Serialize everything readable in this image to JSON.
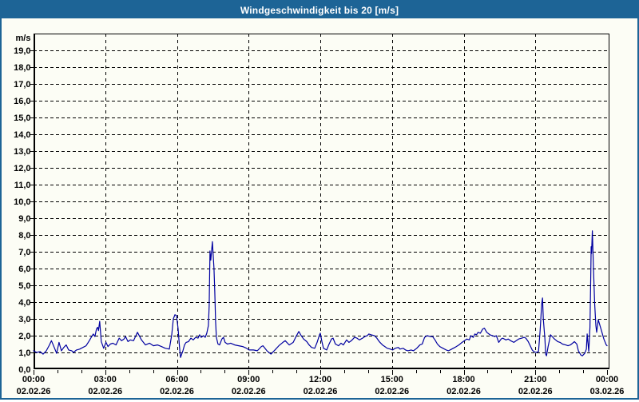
{
  "window": {
    "title": "Windgeschwindigkeit bis 20 [m/s]",
    "title_bar_color": "#1d6496",
    "border_color": "#1d6496",
    "background_color": "#fcfdf5"
  },
  "chart_data": {
    "type": "line",
    "title": "Windgeschwindigkeit bis 20 [m/s]",
    "unit_label": "m/s",
    "ylabel": "m/s",
    "xlabel": "",
    "ylim": [
      0,
      20
    ],
    "y_tick_interval": 1.0,
    "y_tick_labels": [
      "0,0",
      "1,0",
      "2,0",
      "3,0",
      "4,0",
      "5,0",
      "6,0",
      "7,0",
      "8,0",
      "9,0",
      "10,0",
      "11,0",
      "12,0",
      "13,0",
      "14,0",
      "15,0",
      "16,0",
      "17,0",
      "18,0",
      "19,0"
    ],
    "x_total_minutes": 1440,
    "x_minor_tick_minutes": 60,
    "x_major_tick_minutes": 180,
    "grid": "dashed",
    "legend": "none",
    "line_color": "#0000a0",
    "x_ticks": [
      {
        "minutes": 0,
        "time": "00:00",
        "date": "02.02.26"
      },
      {
        "minutes": 180,
        "time": "03:00",
        "date": "02.02.26"
      },
      {
        "minutes": 360,
        "time": "06:00",
        "date": "02.02.26"
      },
      {
        "minutes": 540,
        "time": "09:00",
        "date": "02.02.26"
      },
      {
        "minutes": 720,
        "time": "12:00",
        "date": "02.02.26"
      },
      {
        "minutes": 900,
        "time": "15:00",
        "date": "02.02.26"
      },
      {
        "minutes": 1080,
        "time": "18:00",
        "date": "02.02.26"
      },
      {
        "minutes": 1260,
        "time": "21:00",
        "date": "02.02.26"
      },
      {
        "minutes": 1440,
        "time": "00:00",
        "date": "03.02.26"
      }
    ],
    "series": [
      {
        "name": "Windgeschwindigkeit [m/s]",
        "points": [
          [
            0,
            1.1
          ],
          [
            8,
            1.0
          ],
          [
            16,
            1.05
          ],
          [
            24,
            0.9
          ],
          [
            32,
            1.1
          ],
          [
            40,
            1.45
          ],
          [
            45,
            1.7
          ],
          [
            52,
            1.3
          ],
          [
            58,
            0.95
          ],
          [
            64,
            1.6
          ],
          [
            70,
            1.1
          ],
          [
            76,
            1.3
          ],
          [
            82,
            1.45
          ],
          [
            88,
            1.15
          ],
          [
            96,
            1.1
          ],
          [
            100,
            1.0
          ],
          [
            108,
            1.15
          ],
          [
            116,
            1.2
          ],
          [
            124,
            1.3
          ],
          [
            132,
            1.4
          ],
          [
            140,
            1.7
          ],
          [
            146,
            1.95
          ],
          [
            150,
            2.1
          ],
          [
            154,
            1.95
          ],
          [
            158,
            2.4
          ],
          [
            161,
            2.5
          ],
          [
            163,
            2.3
          ],
          [
            166,
            2.85
          ],
          [
            170,
            1.65
          ],
          [
            176,
            1.25
          ],
          [
            182,
            1.6
          ],
          [
            187,
            1.35
          ],
          [
            193,
            1.5
          ],
          [
            199,
            1.55
          ],
          [
            207,
            1.45
          ],
          [
            215,
            1.85
          ],
          [
            221,
            1.7
          ],
          [
            227,
            1.8
          ],
          [
            231,
            1.95
          ],
          [
            237,
            1.65
          ],
          [
            243,
            1.75
          ],
          [
            251,
            1.7
          ],
          [
            261,
            2.2
          ],
          [
            271,
            1.75
          ],
          [
            281,
            1.45
          ],
          [
            291,
            1.55
          ],
          [
            301,
            1.4
          ],
          [
            311,
            1.45
          ],
          [
            321,
            1.35
          ],
          [
            331,
            1.25
          ],
          [
            341,
            1.2
          ],
          [
            347,
            2.05
          ],
          [
            351,
            3.0
          ],
          [
            355,
            3.25
          ],
          [
            359,
            3.2
          ],
          [
            363,
            2.4
          ],
          [
            366,
            1.45
          ],
          [
            369,
            0.7
          ],
          [
            375,
            1.1
          ],
          [
            379,
            1.45
          ],
          [
            383,
            1.6
          ],
          [
            389,
            1.65
          ],
          [
            395,
            1.85
          ],
          [
            401,
            1.75
          ],
          [
            407,
            1.9
          ],
          [
            413,
            1.85
          ],
          [
            417,
            2.05
          ],
          [
            421,
            1.9
          ],
          [
            427,
            2.0
          ],
          [
            431,
            1.9
          ],
          [
            435,
            2.15
          ],
          [
            439,
            2.6
          ],
          [
            441,
            3.8
          ],
          [
            443,
            7.05
          ],
          [
            445,
            6.5
          ],
          [
            449,
            7.6
          ],
          [
            453,
            6.0
          ],
          [
            455,
            4.6
          ],
          [
            457,
            2.85
          ],
          [
            459,
            1.9
          ],
          [
            463,
            1.5
          ],
          [
            467,
            1.45
          ],
          [
            473,
            1.8
          ],
          [
            477,
            1.9
          ],
          [
            481,
            1.6
          ],
          [
            487,
            1.5
          ],
          [
            495,
            1.55
          ],
          [
            505,
            1.45
          ],
          [
            515,
            1.4
          ],
          [
            525,
            1.35
          ],
          [
            535,
            1.25
          ],
          [
            541,
            1.15
          ],
          [
            552,
            1.15
          ],
          [
            562,
            1.1
          ],
          [
            572,
            1.35
          ],
          [
            576,
            1.4
          ],
          [
            586,
            1.1
          ],
          [
            596,
            0.9
          ],
          [
            606,
            1.15
          ],
          [
            616,
            1.4
          ],
          [
            626,
            1.6
          ],
          [
            632,
            1.7
          ],
          [
            642,
            1.45
          ],
          [
            652,
            1.6
          ],
          [
            658,
            1.9
          ],
          [
            666,
            2.25
          ],
          [
            672,
            2.0
          ],
          [
            678,
            1.8
          ],
          [
            686,
            1.65
          ],
          [
            692,
            1.45
          ],
          [
            698,
            1.3
          ],
          [
            706,
            1.25
          ],
          [
            712,
            1.6
          ],
          [
            718,
            2.05
          ],
          [
            720,
            2.15
          ],
          [
            724,
            1.65
          ],
          [
            728,
            1.25
          ],
          [
            736,
            1.15
          ],
          [
            742,
            1.5
          ],
          [
            748,
            1.8
          ],
          [
            752,
            1.85
          ],
          [
            758,
            1.5
          ],
          [
            766,
            1.4
          ],
          [
            772,
            1.55
          ],
          [
            778,
            1.45
          ],
          [
            786,
            1.75
          ],
          [
            792,
            1.6
          ],
          [
            798,
            1.7
          ],
          [
            806,
            1.9
          ],
          [
            812,
            1.85
          ],
          [
            818,
            1.75
          ],
          [
            826,
            1.85
          ],
          [
            832,
            1.95
          ],
          [
            838,
            2.0
          ],
          [
            842,
            2.1
          ],
          [
            848,
            2.05
          ],
          [
            856,
            2.0
          ],
          [
            862,
            1.85
          ],
          [
            868,
            1.65
          ],
          [
            876,
            1.45
          ],
          [
            882,
            1.35
          ],
          [
            888,
            1.25
          ],
          [
            896,
            1.2
          ],
          [
            902,
            1.15
          ],
          [
            908,
            1.25
          ],
          [
            916,
            1.3
          ],
          [
            920,
            1.2
          ],
          [
            928,
            1.25
          ],
          [
            934,
            1.15
          ],
          [
            940,
            1.1
          ],
          [
            948,
            1.15
          ],
          [
            954,
            1.1
          ],
          [
            962,
            1.25
          ],
          [
            970,
            1.45
          ],
          [
            976,
            1.5
          ],
          [
            982,
            1.9
          ],
          [
            988,
            2.0
          ],
          [
            996,
            1.95
          ],
          [
            1002,
            1.95
          ],
          [
            1008,
            1.75
          ],
          [
            1014,
            1.5
          ],
          [
            1020,
            1.35
          ],
          [
            1028,
            1.25
          ],
          [
            1036,
            1.15
          ],
          [
            1042,
            1.1
          ],
          [
            1050,
            1.2
          ],
          [
            1058,
            1.3
          ],
          [
            1068,
            1.45
          ],
          [
            1076,
            1.6
          ],
          [
            1082,
            1.7
          ],
          [
            1088,
            1.8
          ],
          [
            1094,
            1.75
          ],
          [
            1098,
            2.0
          ],
          [
            1104,
            1.9
          ],
          [
            1108,
            2.1
          ],
          [
            1112,
            2.05
          ],
          [
            1116,
            2.2
          ],
          [
            1122,
            2.15
          ],
          [
            1128,
            2.4
          ],
          [
            1132,
            2.45
          ],
          [
            1138,
            2.2
          ],
          [
            1146,
            2.05
          ],
          [
            1152,
            2.0
          ],
          [
            1158,
            1.95
          ],
          [
            1162,
            2.0
          ],
          [
            1168,
            1.6
          ],
          [
            1174,
            1.8
          ],
          [
            1178,
            1.85
          ],
          [
            1186,
            1.75
          ],
          [
            1192,
            1.8
          ],
          [
            1198,
            1.7
          ],
          [
            1206,
            1.6
          ],
          [
            1212,
            1.7
          ],
          [
            1218,
            1.8
          ],
          [
            1226,
            1.85
          ],
          [
            1232,
            1.9
          ],
          [
            1236,
            1.85
          ],
          [
            1242,
            1.65
          ],
          [
            1248,
            1.35
          ],
          [
            1252,
            1.15
          ],
          [
            1256,
            1.05
          ],
          [
            1262,
            1.0
          ],
          [
            1268,
            1.05
          ],
          [
            1272,
            2.3
          ],
          [
            1276,
            3.9
          ],
          [
            1278,
            4.25
          ],
          [
            1280,
            3.0
          ],
          [
            1284,
            1.8
          ],
          [
            1286,
            0.9
          ],
          [
            1288,
            0.8
          ],
          [
            1292,
            1.35
          ],
          [
            1296,
            1.8
          ],
          [
            1298,
            2.05
          ],
          [
            1304,
            1.9
          ],
          [
            1308,
            1.8
          ],
          [
            1316,
            1.65
          ],
          [
            1322,
            1.6
          ],
          [
            1328,
            1.5
          ],
          [
            1336,
            1.45
          ],
          [
            1342,
            1.4
          ],
          [
            1348,
            1.45
          ],
          [
            1356,
            1.6
          ],
          [
            1358,
            1.65
          ],
          [
            1364,
            1.5
          ],
          [
            1368,
            1.1
          ],
          [
            1374,
            0.85
          ],
          [
            1378,
            0.8
          ],
          [
            1384,
            0.95
          ],
          [
            1388,
            1.2
          ],
          [
            1390,
            2.1
          ],
          [
            1394,
            1.05
          ],
          [
            1397,
            2.5
          ],
          [
            1399,
            5.5
          ],
          [
            1400,
            7.3
          ],
          [
            1401,
            6.9
          ],
          [
            1403,
            8.25
          ],
          [
            1406,
            6.0
          ],
          [
            1409,
            3.9
          ],
          [
            1412,
            2.6
          ],
          [
            1414,
            2.2
          ],
          [
            1418,
            2.95
          ],
          [
            1426,
            2.3
          ],
          [
            1432,
            1.8
          ],
          [
            1438,
            1.45
          ],
          [
            1440,
            1.4
          ]
        ]
      }
    ]
  }
}
